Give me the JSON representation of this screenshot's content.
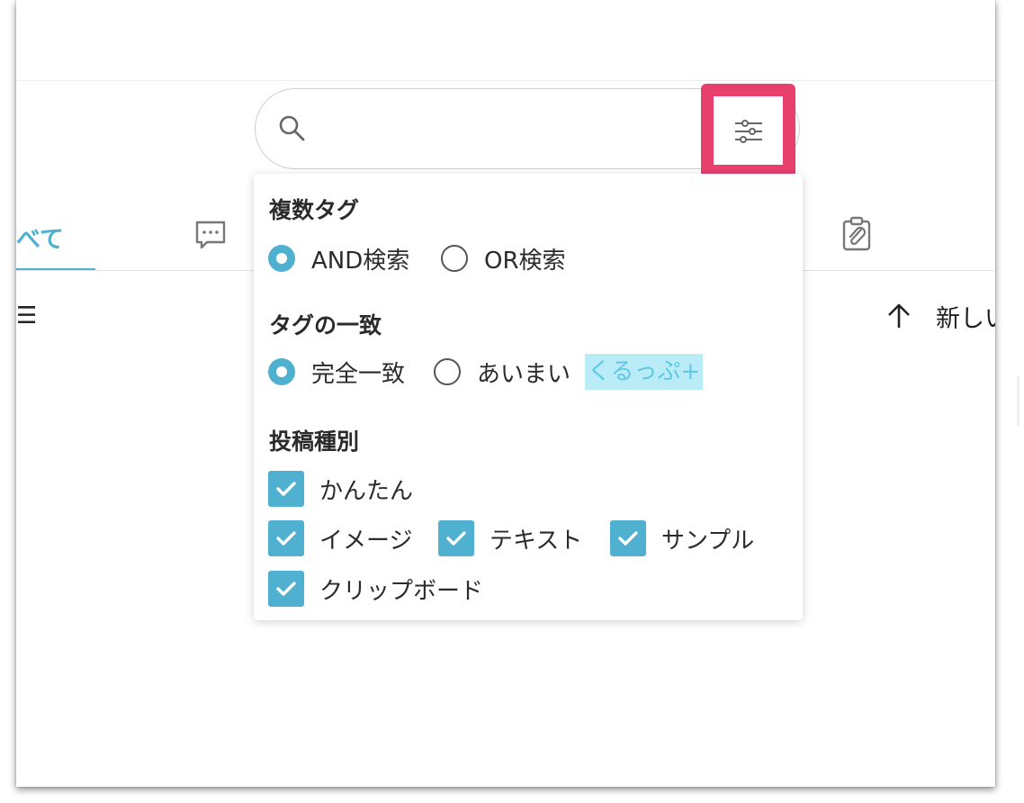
{
  "search": {
    "value": "",
    "placeholder": ""
  },
  "tabs": {
    "all_label": "べて"
  },
  "toolbar": {
    "sort_label": "新しい"
  },
  "filter": {
    "multi_tag": {
      "title": "複数タグ",
      "options": [
        {
          "label": "AND検索",
          "selected": true
        },
        {
          "label": "OR検索",
          "selected": false
        }
      ]
    },
    "tag_match": {
      "title": "タグの一致",
      "options": [
        {
          "label": "完全一致",
          "selected": true
        },
        {
          "label": "あいまい",
          "selected": false
        }
      ],
      "badge": "くるっぷ+"
    },
    "post_type": {
      "title": "投稿種別",
      "options": [
        {
          "label": "かんたん",
          "checked": true
        },
        {
          "label": "イメージ",
          "checked": true
        },
        {
          "label": "テキスト",
          "checked": true
        },
        {
          "label": "サンプル",
          "checked": true
        },
        {
          "label": "クリップボード",
          "checked": true
        }
      ]
    }
  },
  "colors": {
    "accent": "#4fb0cf",
    "highlight": "#e8406d",
    "badge_bg": "#b9ecf6",
    "badge_text": "#5ec8e6"
  },
  "icons": [
    "search-icon",
    "filter-sliders-icon",
    "chat-icon",
    "clipboard-icon",
    "menu-icon",
    "arrow-up-icon",
    "check-icon"
  ]
}
